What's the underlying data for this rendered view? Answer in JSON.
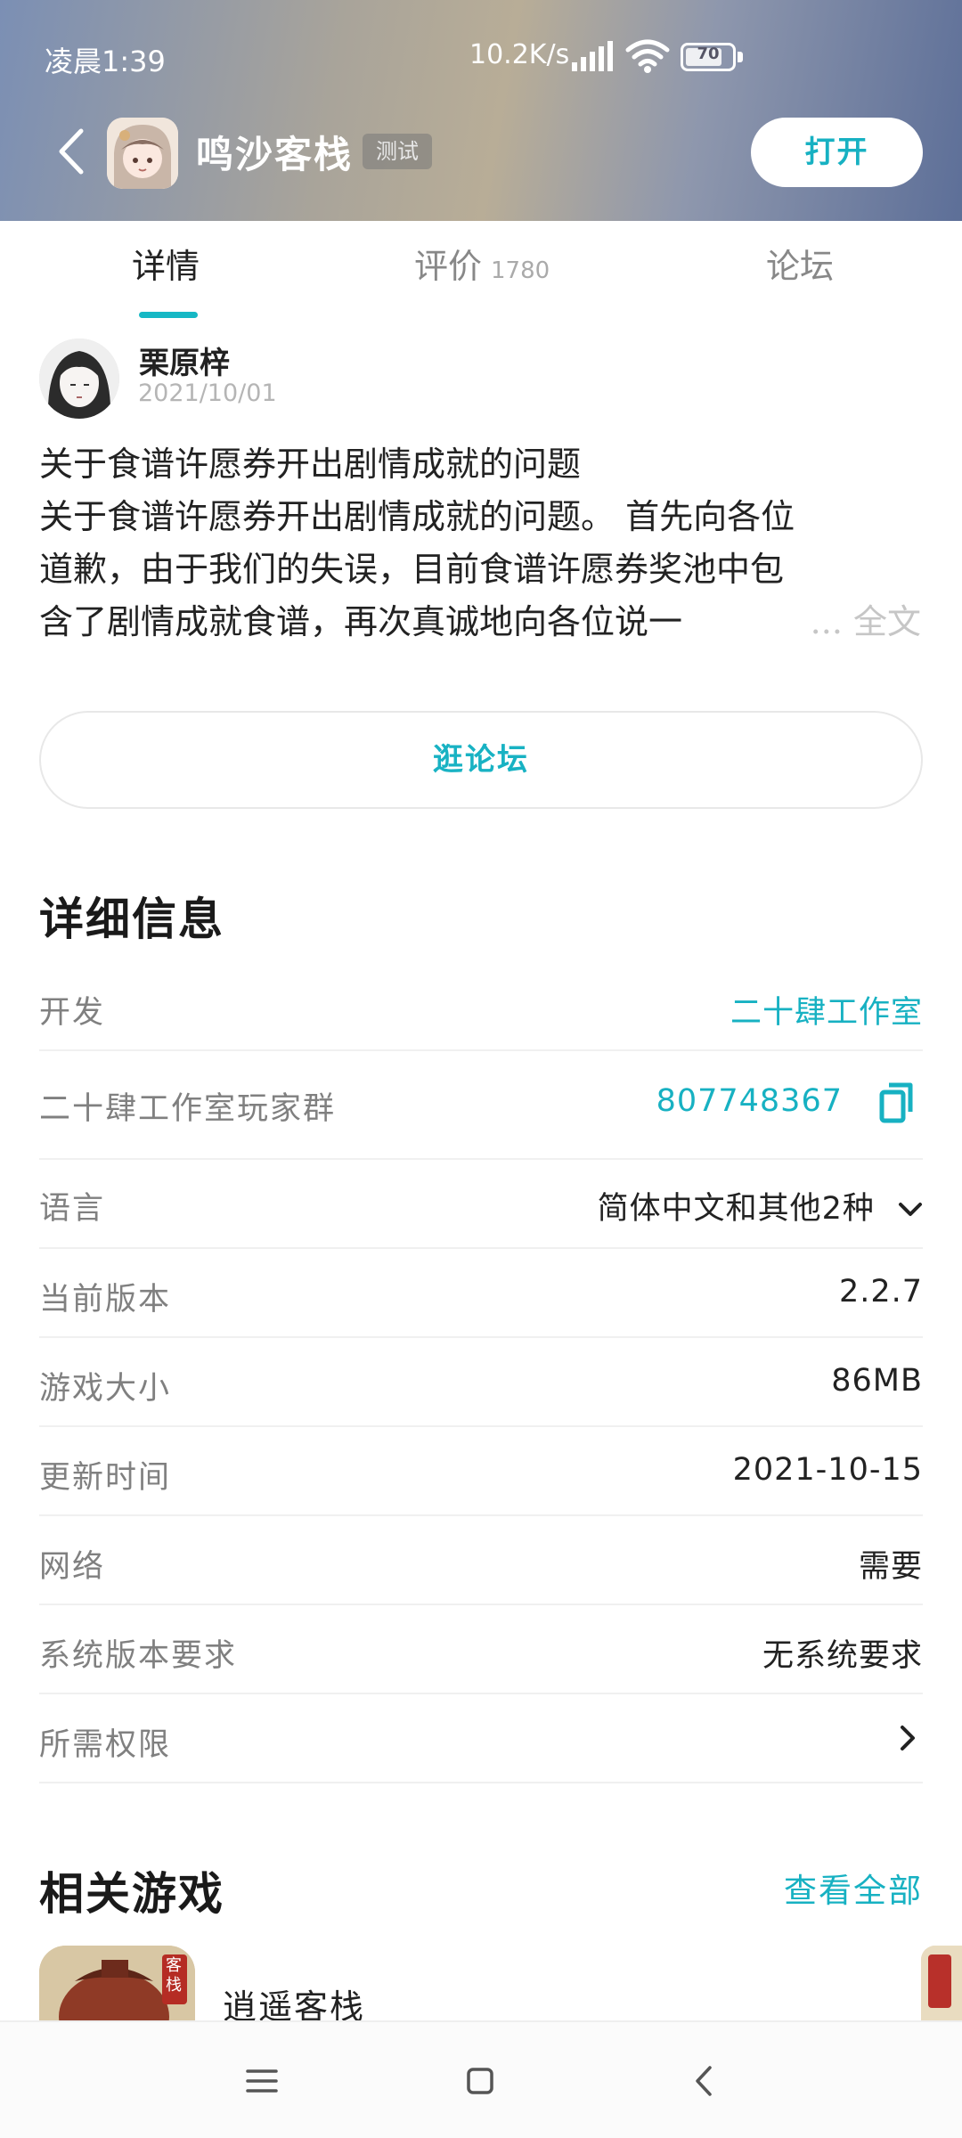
{
  "status_bar": {
    "time": "凌晨1:39",
    "network_speed": "10.2K/s",
    "battery": "70"
  },
  "header": {
    "app_name": "鸣沙客栈",
    "badge": "测试",
    "open_label": "打开"
  },
  "tabs": [
    {
      "label": "详情",
      "active": true
    },
    {
      "label": "评价",
      "count": "1780"
    },
    {
      "label": "论坛"
    }
  ],
  "post": {
    "author": "栗原梓",
    "date": "2021/10/01",
    "title": "关于食谱许愿券开出剧情成就的问题",
    "lines": [
      "关于食谱许愿券开出剧情成就的问题。 首先向各位",
      "道歉，由于我们的失误，目前食谱许愿券奖池中包",
      "含了剧情成就食谱，再次真诚地向各位说一"
    ],
    "read_more": "... 全文"
  },
  "forum_button": "逛论坛",
  "details": {
    "title": "详细信息",
    "rows": [
      {
        "label": "开发",
        "value": "二十肆工作室"
      },
      {
        "label": "二十肆工作室玩家群",
        "value": "807748367"
      },
      {
        "label": "语言",
        "value": "简体中文和其他2种"
      },
      {
        "label": "当前版本",
        "value": "2.2.7"
      },
      {
        "label": "游戏大小",
        "value": "86MB"
      },
      {
        "label": "更新时间",
        "value": "2021-10-15"
      },
      {
        "label": "网络",
        "value": "需要"
      },
      {
        "label": "系统版本要求",
        "value": "无系统要求"
      },
      {
        "label": "所需权限",
        "value": ""
      }
    ]
  },
  "related": {
    "title": "相关游戏",
    "see_all": "查看全部",
    "games": [
      {
        "name": "逍遥客栈",
        "icon_text": "客栈"
      }
    ]
  },
  "colors": {
    "accent": "#17b1c2",
    "header_gradient_left": "#7b8fb4",
    "header_gradient_right": "#5d6f98"
  },
  "icons": [
    "back-arrow-icon",
    "copy-icon",
    "chevron-down-icon",
    "chevron-right-icon",
    "menu-icon",
    "home-square-icon",
    "back-triangle-icon",
    "signal-icon",
    "wifi-icon",
    "battery-icon"
  ]
}
